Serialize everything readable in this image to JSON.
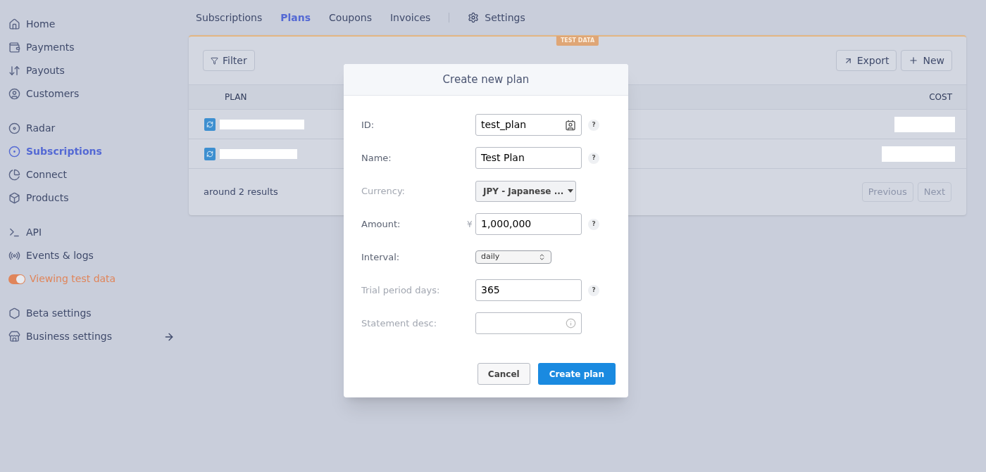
{
  "sidebar": {
    "groups": [
      {
        "items": [
          {
            "label": "Home",
            "selected": false
          },
          {
            "label": "Payments",
            "selected": false
          },
          {
            "label": "Payouts",
            "selected": false
          },
          {
            "label": "Customers",
            "selected": false
          }
        ]
      },
      {
        "items": [
          {
            "label": "Radar",
            "selected": false
          },
          {
            "label": "Subscriptions",
            "selected": true
          },
          {
            "label": "Connect",
            "selected": false
          },
          {
            "label": "Products",
            "selected": false
          }
        ]
      },
      {
        "items": [
          {
            "label": "API",
            "selected": false
          },
          {
            "label": "Events & logs",
            "selected": false
          }
        ],
        "toggle": {
          "label": "Viewing test data",
          "on": true
        }
      },
      {
        "items": [
          {
            "label": "Beta settings",
            "selected": false
          },
          {
            "label": "Business settings",
            "selected": false,
            "arrow": true
          }
        ]
      }
    ]
  },
  "tabs": [
    {
      "label": "Subscriptions",
      "selected": false
    },
    {
      "label": "Plans",
      "selected": true
    },
    {
      "label": "Coupons",
      "selected": false
    },
    {
      "label": "Invoices",
      "selected": false
    }
  ],
  "settings_tab": {
    "label": "Settings",
    "selected": false
  },
  "panel": {
    "badge": "TEST DATA",
    "filter": "Filter",
    "export": "Export",
    "new": "New",
    "columns": [
      "PLAN",
      "COST"
    ],
    "rows": [
      {
        "redacted": true
      },
      {
        "redacted": true
      }
    ],
    "count": "around 2 results",
    "previous": "Previous",
    "next": "Next"
  },
  "dialog": {
    "title": "Create new plan",
    "fields": [
      {
        "label": "ID:",
        "kind": "text",
        "value": "test_plan",
        "optional": false,
        "help": "?"
      },
      {
        "label": "Name:",
        "kind": "text",
        "value": "Test Plan",
        "optional": false,
        "help": "?"
      },
      {
        "label": "Currency:",
        "kind": "dropdown",
        "value": "JPY - Japanese ...",
        "optional": true
      },
      {
        "label": "Amount:",
        "kind": "text",
        "value": "1,000,000",
        "prefix": "¥",
        "optional": false,
        "help": "?"
      },
      {
        "label": "Interval:",
        "kind": "select",
        "value": "daily",
        "optional": false
      },
      {
        "label": "Trial period days:",
        "kind": "text",
        "value": "365",
        "optional": true,
        "help": "?"
      },
      {
        "label": "Statement desc:",
        "kind": "text",
        "optional": true
      }
    ],
    "cancel": "Cancel",
    "submit": "Create plan"
  }
}
